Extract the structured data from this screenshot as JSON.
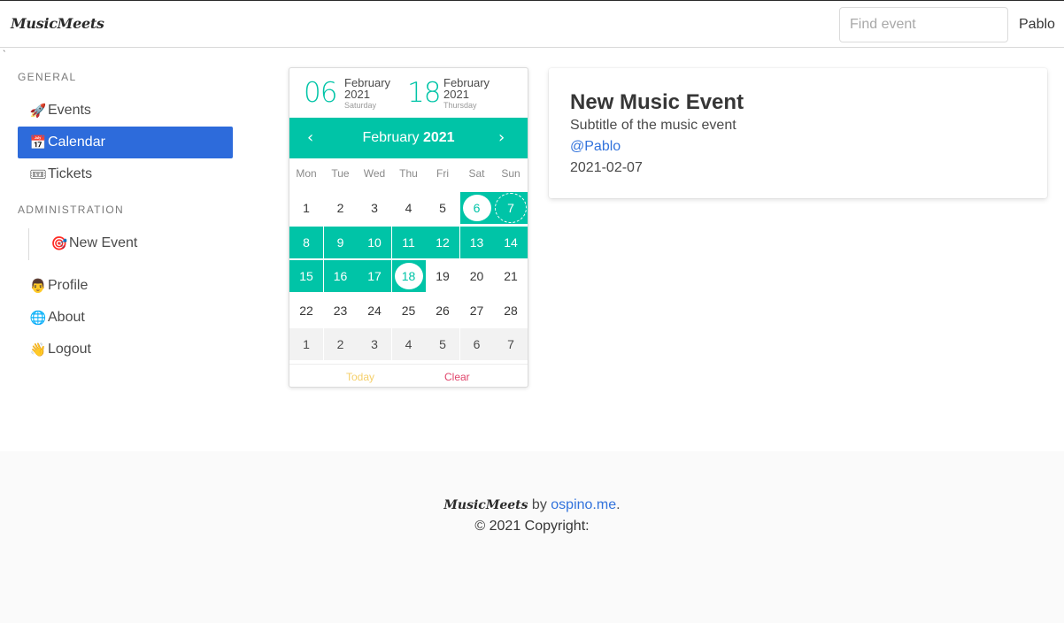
{
  "navbar": {
    "brand": "MusicMeets",
    "search_placeholder": "Find event",
    "user": "Pablo",
    "stray_char": "`"
  },
  "sidebar": {
    "general_label": "General",
    "admin_label": "Administration",
    "items": [
      {
        "icon": "rocket-icon",
        "glyph": "🚀",
        "label": "Events"
      },
      {
        "icon": "calendar-icon",
        "glyph": "📅",
        "label": "Calendar"
      },
      {
        "icon": "ticket-icon",
        "glyph": "🎟",
        "label": "Tickets"
      },
      {
        "icon": "target-icon",
        "glyph": "🎯",
        "label": "New Event"
      },
      {
        "icon": "person-icon",
        "glyph": "👨",
        "label": "Profile"
      },
      {
        "icon": "globe-icon",
        "glyph": "🌐",
        "label": "About"
      },
      {
        "icon": "wave-icon",
        "glyph": "👋",
        "label": "Logout"
      }
    ],
    "active": "Calendar"
  },
  "calendar": {
    "start": {
      "day": "06",
      "month": "February",
      "year": "2021",
      "weekday": "Saturday"
    },
    "end": {
      "day": "18",
      "month": "February",
      "year": "2021",
      "weekday": "Thursday"
    },
    "nav_month": "February",
    "nav_year": "2021",
    "prev_glyph": "‹",
    "next_glyph": "›",
    "weekdays": [
      "Mon",
      "Tue",
      "Wed",
      "Thu",
      "Fri",
      "Sat",
      "Sun"
    ],
    "weeks": [
      [
        "1",
        "2",
        "3",
        "4",
        "5",
        "6",
        "7"
      ],
      [
        "8",
        "9",
        "10",
        "11",
        "12",
        "13",
        "14"
      ],
      [
        "15",
        "16",
        "17",
        "18",
        "19",
        "20",
        "21"
      ],
      [
        "22",
        "23",
        "24",
        "25",
        "26",
        "27",
        "28"
      ],
      [
        "1",
        "2",
        "3",
        "4",
        "5",
        "6",
        "7"
      ]
    ],
    "today_label": "Today",
    "clear_label": "Clear",
    "colors": {
      "accent": "#00c4a7",
      "today": "#f5cf6a",
      "clear": "#e0456b"
    }
  },
  "event": {
    "title": "New Music Event",
    "subtitle": "Subtitle of the music event",
    "author": "@Pablo",
    "date": "2021-02-07"
  },
  "footer": {
    "brand": "MusicMeets",
    "by": " by ",
    "link": "ospino.me",
    "period": ".",
    "copyright": "© 2021 Copyright:"
  }
}
